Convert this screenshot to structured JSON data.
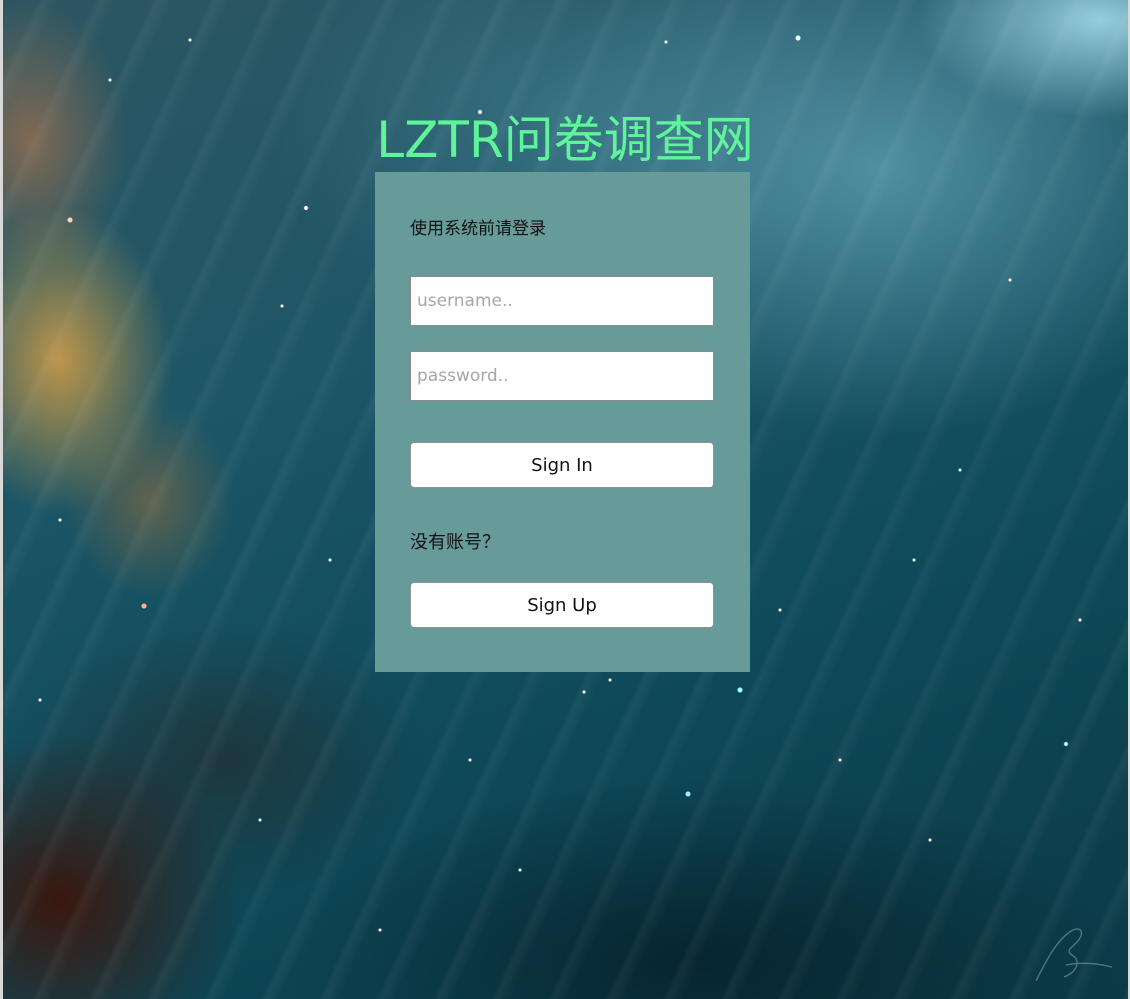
{
  "site": {
    "title": "LZTR问卷调查网",
    "title_color": "#5ef59a"
  },
  "login": {
    "prompt": "使用系统前请登录",
    "username_placeholder": "username..",
    "password_placeholder": "password..",
    "signin_label": "Sign In",
    "no_account_text": "没有账号？",
    "signup_label": "Sign Up",
    "card_color": "#679b9a"
  },
  "icons": {
    "signature": "signature-icon"
  }
}
